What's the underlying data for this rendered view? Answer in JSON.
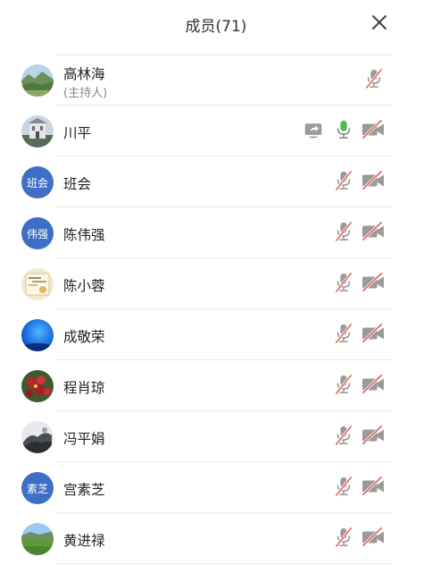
{
  "header": {
    "title": "成员(71)",
    "close_icon": "close-icon"
  },
  "members": [
    {
      "name": "高林海",
      "role": "(主持人)",
      "avatar": "photo-landscape",
      "mic": "muted",
      "camera": "hidden",
      "sharing": false
    },
    {
      "name": "川平",
      "avatar": "photo-building",
      "mic": "active",
      "camera": "off",
      "sharing": true
    },
    {
      "name": "班会",
      "avatar_text": "班会",
      "mic": "muted",
      "camera": "off",
      "sharing": false
    },
    {
      "name": "陈伟强",
      "avatar_text": "伟强",
      "mic": "muted",
      "camera": "off",
      "sharing": false
    },
    {
      "name": "陈小蓉",
      "avatar": "photo-book",
      "mic": "muted",
      "camera": "off",
      "sharing": false
    },
    {
      "name": "成敬荣",
      "avatar": "photo-sky",
      "mic": "muted",
      "camera": "off",
      "sharing": false
    },
    {
      "name": "程肖琼",
      "avatar": "photo-flowers",
      "mic": "muted",
      "camera": "off",
      "sharing": false
    },
    {
      "name": "冯平娟",
      "avatar": "photo-ink",
      "mic": "muted",
      "camera": "off",
      "sharing": false
    },
    {
      "name": "宫素芝",
      "avatar_text": "素芝",
      "mic": "muted",
      "camera": "off",
      "sharing": false
    },
    {
      "name": "黄进禄",
      "avatar": "photo-field",
      "mic": "muted",
      "camera": "off",
      "sharing": false
    }
  ],
  "colors": {
    "muted_red": "#e05a4f",
    "icon_gray": "#9a9a9a",
    "mic_active": "#4cbf4a",
    "avatar_blue": "#3f6fc5"
  }
}
